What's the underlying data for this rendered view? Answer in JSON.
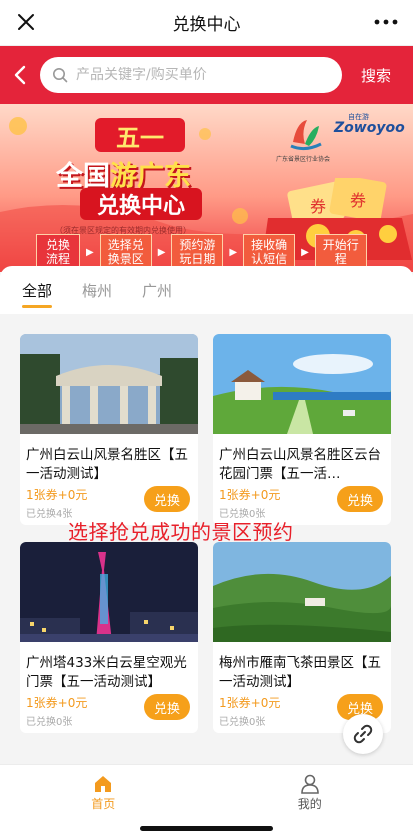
{
  "window": {
    "title": "兑换中心"
  },
  "search": {
    "placeholder": "产品关键字/购买单价",
    "button_label": "搜索"
  },
  "banner": {
    "badge": "五一",
    "headline_pre": "全国",
    "headline_highlight": "游广东",
    "headline_sub": "兑换中心",
    "note": "（须在景区规定的有效期内兑换使用）",
    "partner_a": "广东省景区行业协会",
    "partner_b_cn": "自在游",
    "partner_b": "Zowoyoo",
    "coupon_text": "券",
    "steps": [
      "兑换流程",
      "选择兑换景区",
      "预约游玩日期",
      "接收确认短信",
      "开始行程"
    ]
  },
  "tabs": [
    {
      "label": "全部",
      "active": true
    },
    {
      "label": "梅州",
      "active": false
    },
    {
      "label": "广州",
      "active": false
    }
  ],
  "cards": [
    {
      "title": "广州白云山风景名胜区【五一活动测试】",
      "price": "1张券+0元",
      "sold": "已兑换4张",
      "button": "兑换"
    },
    {
      "title": "广州白云山风景名胜区云台花园门票【五一活…",
      "price": "1张券+0元",
      "sold": "已兑换0张",
      "button": "兑换"
    },
    {
      "title": "广州塔433米白云星空观光门票【五一活动测试】",
      "price": "1张券+0元",
      "sold": "已兑换0张",
      "button": "兑换"
    },
    {
      "title": "梅州市雁南飞茶田景区【五一活动测试】",
      "price": "1张券+0元",
      "sold": "已兑换0张",
      "button": "兑换"
    }
  ],
  "overlay_caption": "选择抢兑成功的景区预约",
  "bottom_nav": [
    {
      "label": "首页",
      "icon": "home-icon",
      "active": true
    },
    {
      "label": "我的",
      "icon": "user-icon",
      "active": false
    }
  ],
  "colors": {
    "brand_red": "#e4243a",
    "accent_orange": "#f6a01a"
  }
}
